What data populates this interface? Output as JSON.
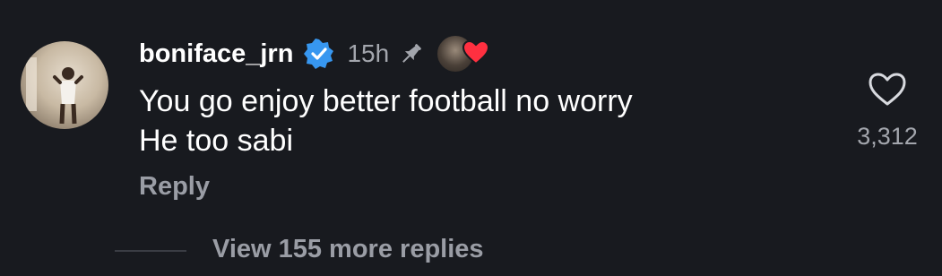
{
  "comment": {
    "username": "boniface_jrn",
    "timestamp": "15h",
    "text_lines": [
      "You go enjoy better football no worry",
      "He too sabi"
    ],
    "reply_label": "Reply",
    "like_count": "3,312",
    "verified_color": "#3797f0",
    "heart_color": "#ff3040",
    "icons": [
      "avatar",
      "verified-badge-icon",
      "pin-icon",
      "creator-liked-heart-icon",
      "heart-outline-icon"
    ]
  },
  "replies": {
    "view_more_label": "View 155 more replies"
  }
}
